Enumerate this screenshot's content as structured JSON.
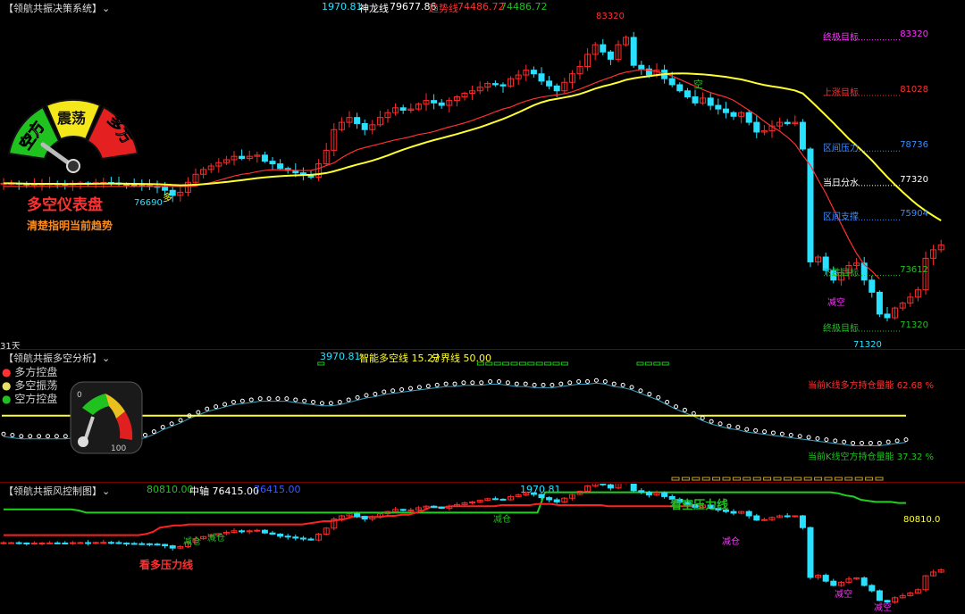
{
  "colors": {
    "up": "#ff2a2a",
    "down": "#28e0ff",
    "fast": "#ff3030",
    "slow": "#ffff30",
    "mid": "#20c020",
    "target_mag": "#ff30ff",
    "target_red": "#ff3030",
    "target_blue": "#3a8cff",
    "target_green": "#20c020",
    "dot": "#ffffff",
    "pink": "#ff3399"
  },
  "panel1": {
    "title": "【领航共振决策系统】⌄",
    "h_1": "1970.81",
    "h_2_label": "神龙线",
    "h_2_value": "79677.86",
    "h_3_label": "趋势线",
    "h_3_value": "74486.72",
    "h_4_value": "74486.72",
    "gauge": {
      "left": "空方",
      "mid": "震荡",
      "right": "多方",
      "title": "多空仪表盘",
      "subtitle": "清楚指明当前趋势"
    },
    "price_hi": "83320",
    "price_lo1": "76690",
    "price_lo2": "71320",
    "tag_duo": "多",
    "tag_kong": "空",
    "tag_jiankong": "减空",
    "days": "31天",
    "targets": [
      {
        "label": "终极目标",
        "value": "83320",
        "color": "target_mag"
      },
      {
        "label": "上涨目标",
        "value": "81028",
        "color": "target_red"
      },
      {
        "label": "区间压力",
        "value": "78736",
        "color": "target_blue"
      },
      {
        "label": "当日分水",
        "value": "77320",
        "color": "white"
      },
      {
        "label": "区间支撑",
        "value": "75904",
        "color": "target_blue"
      },
      {
        "label": "下跌目标",
        "value": "73612",
        "color": "target_green"
      },
      {
        "label": "终极目标",
        "value": "71320",
        "color": "target_green"
      }
    ]
  },
  "panel2": {
    "title": "【领航共振多空分析】⌄",
    "h_1": "3970.81",
    "h_2": "智能多空线 15.27",
    "h_3": "分界线 50.00",
    "legend": [
      {
        "label": "多方控盘",
        "color": "#ff3030"
      },
      {
        "label": "多空振荡",
        "color": "#e8e060"
      },
      {
        "label": "空方控盘",
        "color": "#20c020"
      }
    ],
    "g_min": "0",
    "g_max": "100",
    "ratio_bull": "当前K线多方持仓量能  62.68 %",
    "ratio_bear": "当前K线空方持仓量能  37.32 %"
  },
  "panel3": {
    "title": "【领航共振风控制图】⌄",
    "h_1": "80810.00",
    "h_2": "中轴 76415.00",
    "h_3": "76415.00",
    "h_4": "1970.81",
    "kan_kong": "看空压力线",
    "kan_duo": "看多压力线",
    "r_value": "80810.0",
    "jian_cang": "减仓",
    "jian_kong": "减空"
  },
  "chart_data": [
    {
      "type": "candlestick",
      "title": "",
      "y_range": [
        70400,
        84300
      ],
      "values": [
        77190,
        77190,
        77160,
        77140,
        77150,
        77160,
        77170,
        77155,
        77130,
        77190,
        77200,
        77180,
        77210,
        77220,
        77200,
        77150,
        77120,
        77100,
        77090,
        77060,
        77030,
        76900,
        76690,
        76820,
        77230,
        77560,
        77760,
        77900,
        78040,
        78160,
        78300,
        78210,
        78300,
        78350,
        78100,
        77990,
        77800,
        77720,
        77620,
        77530,
        77440,
        77990,
        78550,
        79400,
        79700,
        79900,
        79650,
        79400,
        79600,
        79900,
        80100,
        80300,
        80200,
        80250,
        80450,
        80600,
        80500,
        80400,
        80600,
        80750,
        80900,
        81000,
        81150,
        81300,
        81250,
        81200,
        81500,
        81650,
        81850,
        81700,
        81400,
        81200,
        81000,
        81350,
        81700,
        82000,
        82500,
        82900,
        82600,
        82300,
        82900,
        83200,
        82050,
        81900,
        81650,
        81850,
        81500,
        81250,
        81000,
        80750,
        80500,
        80700,
        80400,
        80250,
        80100,
        79950,
        80100,
        79700,
        79300,
        79350,
        79550,
        79700,
        79650,
        79700,
        78600,
        73950,
        74150,
        73600,
        73200,
        73500,
        73800,
        73900,
        73200,
        72700,
        71800,
        71650,
        72050,
        72250,
        72500,
        72800,
        74100,
        74450,
        74650
      ],
      "fast_line": [
        77060,
        77060,
        77060,
        77060,
        77060,
        77060,
        77060,
        77060,
        77060,
        77060,
        77060,
        77060,
        77060,
        77060,
        77060,
        77060,
        77060,
        77060,
        77060,
        77060,
        77060,
        77060,
        77060,
        77060,
        77060,
        77080,
        77160,
        77220,
        77310,
        77400,
        77490,
        77560,
        77600,
        77670,
        77720,
        77750,
        77740,
        77740,
        77720,
        77710,
        77720,
        77800,
        77920,
        78030,
        78240,
        78420,
        78570,
        78660,
        78740,
        78820,
        78900,
        78980,
        79040,
        79110,
        79200,
        79250,
        79320,
        79420,
        79510,
        79590,
        79680,
        79780,
        79900,
        80010,
        80140,
        80250,
        80330,
        80470,
        80580,
        80670,
        80740,
        80790,
        80830,
        80880,
        80960,
        81070,
        81200,
        81330,
        81450,
        81560,
        81680,
        81770,
        81820,
        81880,
        81850,
        81790,
        81710,
        81610,
        81470,
        81330,
        81190,
        81050,
        80930,
        80830,
        80740,
        80610,
        80400,
        80200,
        79990,
        79740,
        79520,
        79340,
        79090,
        78800,
        78340,
        77920,
        77330,
        76780,
        76130,
        75510,
        74880,
        74300,
        73840,
        73570,
        73250
      ]
    },
    {
      "type": "oscillator_dots",
      "title": "",
      "y_range": [
        -5,
        100
      ],
      "divider": 50,
      "values": [
        34,
        33,
        32,
        32,
        32,
        32,
        32,
        32,
        33,
        34,
        35,
        35,
        35,
        34,
        32,
        31,
        33,
        36,
        40,
        43,
        46,
        50,
        53,
        56,
        58,
        60,
        62,
        63,
        64,
        65,
        65,
        65,
        65,
        64,
        63,
        62,
        61,
        61,
        62,
        64,
        66,
        68,
        69,
        71,
        72,
        73,
        74,
        75,
        76,
        77,
        78,
        78,
        79,
        79,
        79,
        80,
        80,
        79,
        78,
        78,
        77,
        77,
        77,
        78,
        79,
        80,
        80,
        81,
        80,
        78,
        77,
        75,
        72,
        69,
        66,
        62,
        58,
        55,
        52,
        48,
        45,
        43,
        41,
        40,
        38,
        37,
        36,
        35,
        34,
        33,
        32,
        31,
        30,
        29,
        28,
        27,
        26,
        26,
        26,
        26,
        27,
        28,
        29
      ],
      "markers_top": [
        17,
        36,
        37,
        38,
        39,
        40,
        41,
        42,
        43,
        44,
        45,
        46,
        55,
        56,
        57,
        58
      ],
      "markers_bottom": [
        96,
        97,
        98,
        99,
        100,
        101,
        102,
        103,
        104,
        105,
        106,
        107,
        108,
        109,
        110,
        111,
        112,
        113,
        114,
        115,
        116
      ]
    },
    {
      "type": "line",
      "title": "",
      "y_range": [
        70700,
        82200
      ],
      "kan_kong_line": [
        80300,
        80300,
        80300,
        80300,
        80300,
        80300,
        80300,
        80300,
        80300,
        80300,
        80200,
        80000,
        80000,
        80000,
        80000,
        80000,
        80000,
        80000,
        80000,
        80000,
        80000,
        80000,
        80000,
        80000,
        80000,
        80000,
        80000,
        80000,
        80000,
        80000,
        80000,
        80000,
        80000,
        80000,
        80000,
        80000,
        80000,
        80000,
        80000,
        80000,
        80000,
        80000,
        80000,
        80000,
        80000,
        80000,
        80000,
        80000,
        80000,
        80000,
        80000,
        80000,
        80000,
        80000,
        80000,
        80000,
        80000,
        80000,
        80000,
        80000,
        80000,
        80000,
        80000,
        80000,
        80000,
        80000,
        80000,
        80000,
        80000,
        80000,
        80000,
        80000,
        81900,
        81900,
        81900,
        81900,
        81900,
        81900,
        81900,
        81900,
        81900,
        81900,
        81900,
        81900,
        81900,
        81900,
        81900,
        81900,
        81900,
        81900,
        81900,
        81900,
        81900,
        81900,
        81900,
        81900,
        81900,
        81900,
        81900,
        81900,
        81900,
        81900,
        81900,
        81900,
        81900,
        81900,
        81900,
        81900,
        81900,
        81900,
        81900,
        81800,
        81600,
        81500,
        81200,
        81100,
        81000,
        81000,
        81000,
        80900,
        80900
      ],
      "kan_duo_line": [
        77900,
        77900,
        77900,
        77900,
        77900,
        77900,
        77900,
        77900,
        77900,
        77900,
        77900,
        77900,
        77900,
        77900,
        77900,
        77900,
        77900,
        77900,
        77900,
        77900,
        78000,
        78200,
        78600,
        78700,
        78800,
        78800,
        78900,
        78900,
        78900,
        78900,
        78900,
        78900,
        78900,
        78900,
        78900,
        78900,
        78900,
        78900,
        78900,
        78900,
        78900,
        78900,
        78900,
        79000,
        79100,
        79200,
        79200,
        79300,
        79400,
        79600,
        79600,
        79600,
        79600,
        79600,
        79700,
        79700,
        79800,
        79800,
        80000,
        80200,
        80500,
        80500,
        80500,
        80600,
        80600,
        80600,
        80600,
        80600,
        80600,
        80600,
        80700,
        80700,
        80700,
        80700,
        80700,
        80800,
        80800,
        80800,
        80700,
        80700,
        80700,
        80700,
        80700,
        80700,
        80700,
        80600,
        80600,
        80600,
        80600,
        80600,
        80600,
        80600,
        80600,
        80600,
        80600,
        80600,
        80600,
        80600,
        80600
      ]
    }
  ]
}
